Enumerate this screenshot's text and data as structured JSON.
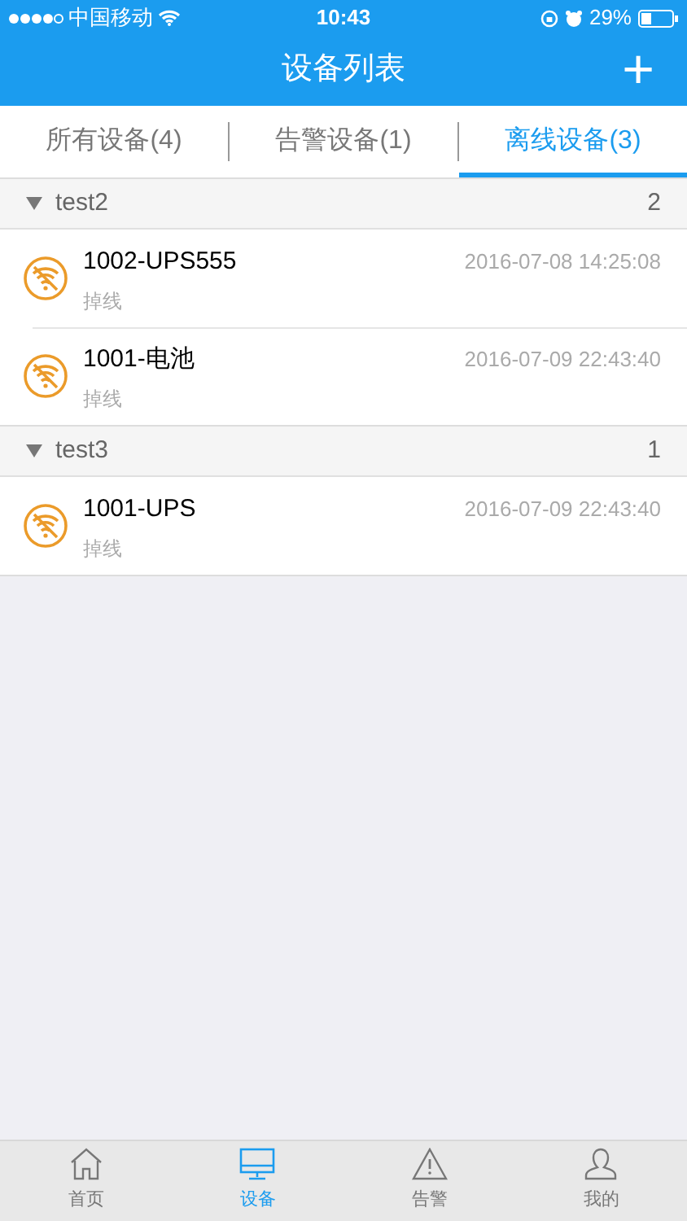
{
  "status_bar": {
    "carrier": "中国移动",
    "time": "10:43",
    "battery": "29%"
  },
  "nav": {
    "title": "设备列表",
    "action": "+"
  },
  "tabs": [
    {
      "label": "所有设备(4)",
      "selected": false
    },
    {
      "label": "告警设备(1)",
      "selected": false
    },
    {
      "label": "离线设备(3)",
      "selected": true
    }
  ],
  "groups": [
    {
      "name": "test2",
      "count": "2",
      "expanded": true,
      "devices": [
        {
          "name": "1002-UPS555",
          "status": "掉线",
          "time": "2016-07-08 14:25:08"
        },
        {
          "name": "1001-电池",
          "status": "掉线",
          "time": "2016-07-09 22:43:40"
        }
      ]
    },
    {
      "name": "test3",
      "count": "1",
      "expanded": true,
      "devices": [
        {
          "name": "1001-UPS",
          "status": "掉线",
          "time": "2016-07-09 22:43:40"
        }
      ]
    }
  ],
  "tab_bar": [
    {
      "label": "首页",
      "selected": false
    },
    {
      "label": "设备",
      "selected": true
    },
    {
      "label": "告警",
      "selected": false
    },
    {
      "label": "我的",
      "selected": false
    }
  ]
}
